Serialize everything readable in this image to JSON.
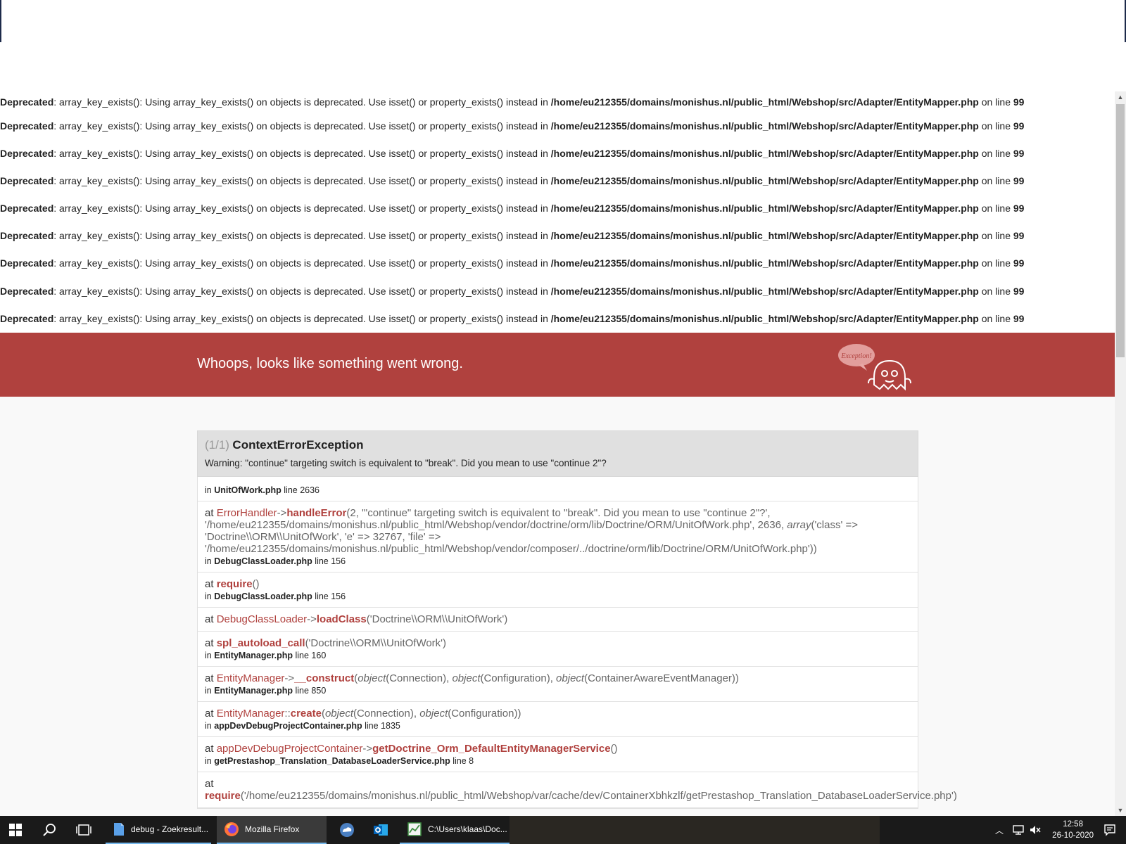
{
  "deprecation": {
    "label": "Deprecated",
    "message": ": array_key_exists(): Using array_key_exists() on objects is deprecated. Use isset() or property_exists() instead in ",
    "file": "/home/eu212355/domains/monishus.nl/public_html/Webshop/src/Adapter/EntityMapper.php",
    "online": " on line ",
    "line": "99",
    "count": 9
  },
  "header": {
    "message": "Whoops, looks like something went wrong.",
    "ghost_text": "Exception!"
  },
  "exception": {
    "counter": "(1/1)",
    "class": "ContextErrorException",
    "message": "Warning: \"continue\" targeting switch is equivalent to \"break\". Did you mean to use \"continue 2\"?",
    "first_location": {
      "prefix": "in ",
      "file": "UnitOfWork.php",
      "line": " line 2636"
    }
  },
  "trace": [
    {
      "at": "at ",
      "class": "ErrorHandler",
      "op": "->",
      "method": "handleError",
      "args": "(2, '\"continue\" targeting switch is equivalent to \"break\". Did you mean to use \"continue 2\"?', '/home/eu212355/domains/monishus.nl/public_html/Webshop/vendor/doctrine/orm/lib/Doctrine/ORM/UnitOfWork.php', 2636, ",
      "args_italic": "array",
      "args_tail": "('class' => 'Doctrine\\\\ORM\\\\UnitOfWork', 'e' => 32767, 'file' => '/home/eu212355/domains/monishus.nl/public_html/Webshop/vendor/composer/../doctrine/orm/lib/Doctrine/ORM/UnitOfWork.php'))",
      "loc_prefix": "in ",
      "loc_file": "DebugClassLoader.php",
      "loc_line": " line 156"
    },
    {
      "at": "at ",
      "method": "require",
      "args": "()",
      "loc_prefix": "in ",
      "loc_file": "DebugClassLoader.php",
      "loc_line": " line 156"
    },
    {
      "at": "at ",
      "class": "DebugClassLoader",
      "op": "->",
      "method": "loadClass",
      "args": "('Doctrine\\\\ORM\\\\UnitOfWork')"
    },
    {
      "at": "at ",
      "method": "spl_autoload_call",
      "args": "('Doctrine\\\\ORM\\\\UnitOfWork')",
      "loc_prefix": "in ",
      "loc_file": "EntityManager.php",
      "loc_line": " line 160"
    },
    {
      "at": "at ",
      "class": "EntityManager",
      "op": "->",
      "method": "__construct",
      "a1i": "object",
      "a1": "(Connection), ",
      "a2i": "object",
      "a2": "(Configuration), ",
      "a3i": "object",
      "a3": "(ContainerAwareEventManager))",
      "loc_prefix": "in ",
      "loc_file": "EntityManager.php",
      "loc_line": " line 850"
    },
    {
      "at": "at ",
      "class": "EntityManager",
      "op": "::",
      "method": "create",
      "a1i": "object",
      "a1": "(Connection), ",
      "a2i": "object",
      "a2": "(Configuration))",
      "loc_prefix": "in ",
      "loc_file": "appDevDebugProjectContainer.php",
      "loc_line": " line 1835"
    },
    {
      "at": "at ",
      "class": "appDevDebugProjectContainer",
      "op": "->",
      "method": "getDoctrine_Orm_DefaultEntityManagerService",
      "args": "()",
      "loc_prefix": "in ",
      "loc_file": "getPrestashop_Translation_DatabaseLoaderService.php",
      "loc_line": " line 8"
    },
    {
      "at": "at ",
      "method": "require",
      "args": "('/home/eu212355/domains/monishus.nl/public_html/Webshop/var/cache/dev/ContainerXbhkzlf/getPrestashop_Translation_DatabaseLoaderService.php')"
    }
  ],
  "taskbar": {
    "tasks": [
      {
        "label": "debug - Zoekresult..."
      },
      {
        "label": "Mozilla Firefox"
      },
      {
        "label": ""
      },
      {
        "label": ""
      },
      {
        "label": "C:\\Users\\klaas\\Doc..."
      }
    ],
    "time": "12:58",
    "date": "26-10-2020"
  },
  "colors": {
    "accent": "#b0413e",
    "taskbar": "#1a1a1a"
  }
}
